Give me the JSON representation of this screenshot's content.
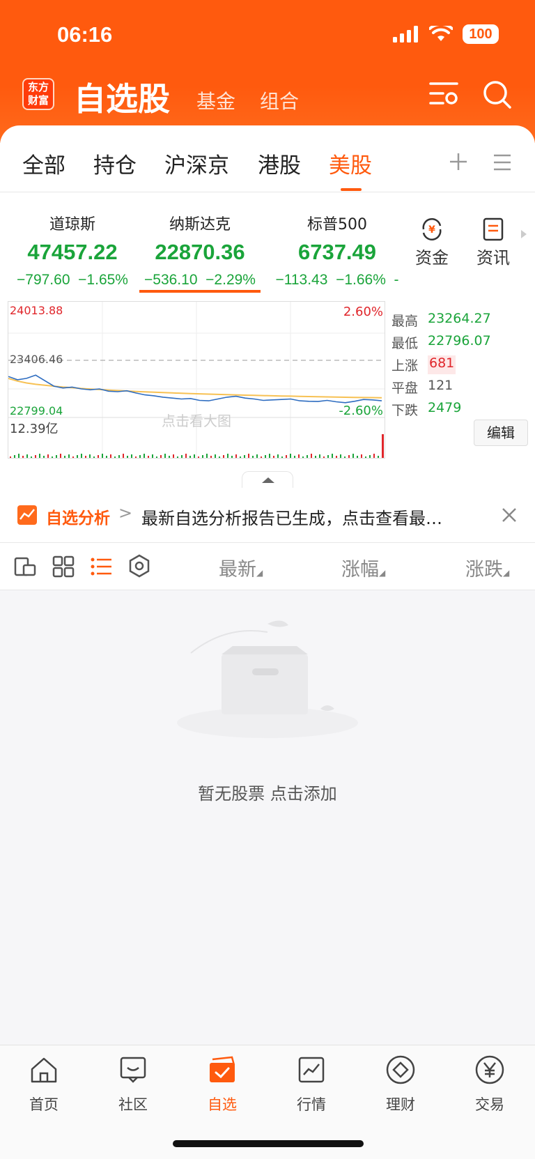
{
  "status_bar": {
    "time": "06:16",
    "battery": "100"
  },
  "header": {
    "logo_line1": "东方",
    "logo_line2": "财富",
    "title": "自选股",
    "tab_fund": "基金",
    "tab_combo": "组合",
    "settings_icon": "list-settings-icon",
    "search_icon": "search-icon"
  },
  "tabs": [
    "全部",
    "持仓",
    "沪深京",
    "港股",
    "美股"
  ],
  "active_tab": "美股",
  "indices": [
    {
      "name": "道琼斯",
      "value": "47457.22",
      "change": "−797.60",
      "pct": "−1.65%"
    },
    {
      "name": "纳斯达克",
      "value": "22870.36",
      "change": "−536.10",
      "pct": "−2.29%"
    },
    {
      "name": "标普500",
      "value": "6737.49",
      "change": "−113.43",
      "pct": "−1.66%",
      "trail": "-"
    }
  ],
  "side_buttons": {
    "fund_flow": "资金",
    "news": "资讯"
  },
  "chart": {
    "high_label": "24013.88",
    "mid_label": "23406.46",
    "low_label": "22799.04",
    "high_pct": "2.60%",
    "low_pct": "-2.60%",
    "volume": "12.39亿",
    "watermark": "点击看大图"
  },
  "chart_data": {
    "type": "line",
    "ylim": [
      22799.04,
      24013.88
    ],
    "reference": 23406.46,
    "series": [
      {
        "values": [
          23230,
          23195,
          23210,
          23245,
          23185,
          23125,
          23105,
          23115,
          23095,
          23085,
          23095,
          23070,
          23065,
          23075,
          23050,
          23030,
          23020,
          23005,
          22995,
          22985,
          22990,
          22970,
          22965,
          22985,
          23005,
          23015,
          22995,
          22985,
          22970,
          22975,
          22980,
          22985,
          22965,
          22960,
          22958,
          22970,
          22955,
          22945,
          22960,
          22980,
          22975,
          22965
        ]
      },
      {
        "values": [
          23210,
          23180,
          23160,
          23145,
          23135,
          23125,
          23115,
          23108,
          23100,
          23094,
          23088,
          23082,
          23077,
          23072,
          23067,
          23063,
          23059,
          23055,
          23051,
          23047,
          23044,
          23041,
          23038,
          23035,
          23032,
          23030,
          23027,
          23025,
          23022,
          23020,
          23018,
          23016,
          23014,
          23012,
          23010,
          23008,
          23006,
          23004,
          23002,
          23001,
          23000,
          22999
        ]
      }
    ],
    "grid": true
  },
  "stats": [
    {
      "label": "最高",
      "value": "23264.27",
      "color": "#1aa43a"
    },
    {
      "label": "最低",
      "value": "22796.07",
      "color": "#1aa43a"
    },
    {
      "label": "上涨",
      "value": "681",
      "color": "#e0262b"
    },
    {
      "label": "平盘",
      "value": "121",
      "color": "#555555"
    },
    {
      "label": "下跌",
      "value": "2479",
      "color": "#1aa43a"
    }
  ],
  "edit_label": "编辑",
  "analysis": {
    "title": "自选分析",
    "chevron": ">",
    "message": "最新自选分析报告已生成，点击查看最…",
    "close_icon": "close-icon"
  },
  "sort_bar": {
    "col_latest": "最新",
    "col_pct": "涨幅",
    "col_change": "涨跌"
  },
  "empty_message": "暂无股票 点击添加",
  "tabbar": [
    "首页",
    "社区",
    "自选",
    "行情",
    "理财",
    "交易"
  ],
  "active_tabbar": "自选",
  "colors": {
    "accent": "#ff5a0e",
    "down": "#1aa43a",
    "up": "#e0262b"
  }
}
